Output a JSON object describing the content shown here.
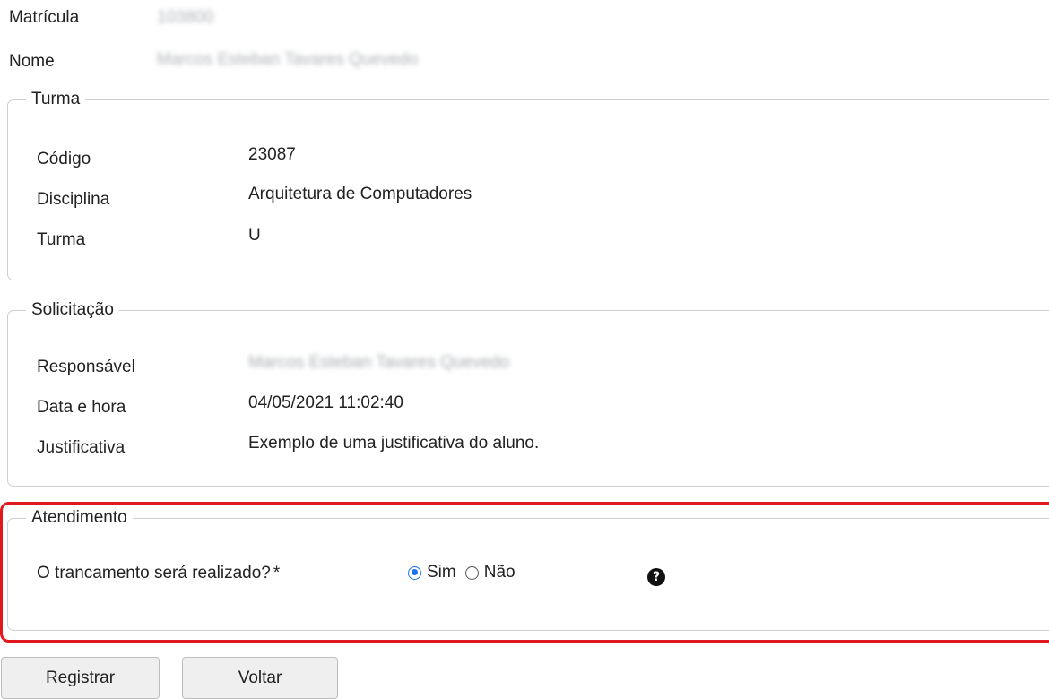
{
  "header": {
    "matricula_label": "Matrícula",
    "matricula_value": "103800",
    "nome_label": "Nome",
    "nome_value": "Marcos Esteban Tavares Quevedo"
  },
  "turma": {
    "legend": "Turma",
    "rows": [
      {
        "label": "Código",
        "value": "23087"
      },
      {
        "label": "Disciplina",
        "value": "Arquitetura de Computadores"
      },
      {
        "label": "Turma",
        "value": "U"
      }
    ]
  },
  "solicitacao": {
    "legend": "Solicitação",
    "rows": [
      {
        "label": "Responsável",
        "value": "Marcos Esteban Tavares Quevedo"
      },
      {
        "label": "Data e hora",
        "value": "04/05/2021 11:02:40"
      },
      {
        "label": "Justificativa",
        "value": "Exemplo de uma justificativa do aluno."
      }
    ]
  },
  "atendimento": {
    "legend": "Atendimento",
    "question": "O trancamento será realizado?",
    "required_mark": "*",
    "options": [
      {
        "label": "Sim",
        "checked": true
      },
      {
        "label": "Não",
        "checked": false
      }
    ],
    "help_icon": "question-circle-icon",
    "help_glyph": "?",
    "highlight_color": "#e0191e"
  },
  "buttons": {
    "registrar": "Registrar",
    "voltar": "Voltar"
  },
  "colors": {
    "radio_accent": "#1a73e8",
    "border": "#cfcfcf"
  }
}
